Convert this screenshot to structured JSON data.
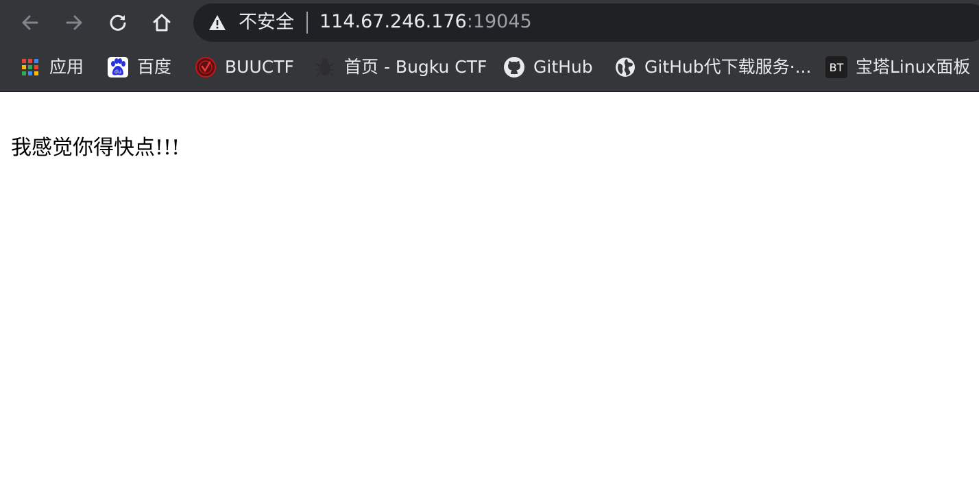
{
  "browser": {
    "security_label": "不安全",
    "url_host": "114.67.246.176",
    "url_port": ":19045",
    "bookmarks": [
      {
        "label": "应用",
        "icon": "apps-grid-icon"
      },
      {
        "label": "百度",
        "icon": "baidu-icon"
      },
      {
        "label": "BUUCTF",
        "icon": "buuctf-icon"
      },
      {
        "label": "首页 - Bugku CTF",
        "icon": "bugku-icon"
      },
      {
        "label": "GitHub",
        "icon": "github-icon"
      },
      {
        "label": "GitHub代下载服务·...",
        "icon": "globe-icon"
      },
      {
        "label": "宝塔Linux面板",
        "icon": "bt-icon",
        "icon_text": "BT"
      }
    ]
  },
  "page": {
    "message": "我感觉你得快点!!!"
  },
  "colors": {
    "chrome_bg": "#35363a",
    "omnibox_bg": "#202124",
    "text_light": "#e8eaed",
    "text_dim": "#9aa0a6",
    "baidu_blue": "#2932e1",
    "buuctf_red": "#c4161c"
  }
}
